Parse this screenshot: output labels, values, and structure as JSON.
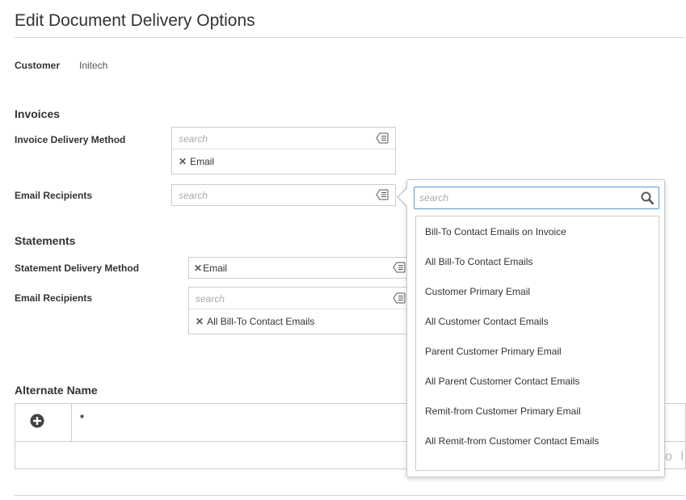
{
  "page": {
    "title": "Edit Document Delivery Options"
  },
  "customer": {
    "label": "Customer",
    "value": "Initech"
  },
  "invoices": {
    "section_title": "Invoices",
    "delivery_method": {
      "label": "Invoice Delivery Method",
      "placeholder": "search",
      "tokens": [
        "Email"
      ]
    },
    "email_recipients": {
      "label": "Email Recipients",
      "placeholder": "search"
    }
  },
  "statements": {
    "section_title": "Statements",
    "delivery_method": {
      "label": "Statement Delivery Method",
      "tokens": [
        "Email"
      ]
    },
    "email_recipients": {
      "label": "Email Recipients",
      "placeholder": "search",
      "tokens": [
        "All Bill-To Contact Emails"
      ]
    }
  },
  "alternate_name": {
    "section_title": "Alternate Name",
    "column_header": "*",
    "partial_text": "o l"
  },
  "dropdown": {
    "search_placeholder": "search",
    "options": [
      "Bill-To Contact Emails on Invoice",
      "All Bill-To Contact Emails",
      "Customer Primary Email",
      "All Customer Contact Emails",
      "Parent Customer Primary Email",
      "All Parent Customer Contact Emails",
      "Remit-from Customer Primary Email",
      "All Remit-from Customer Contact Emails"
    ]
  },
  "icons": {
    "list": "list-icon",
    "remove": "remove-x-icon",
    "add": "add-circle-icon",
    "search": "magnifier-icon"
  },
  "colors": {
    "focus_border": "#5b9bd5",
    "border": "#cccccc",
    "placeholder": "#aaaaaa",
    "text": "#333333"
  }
}
